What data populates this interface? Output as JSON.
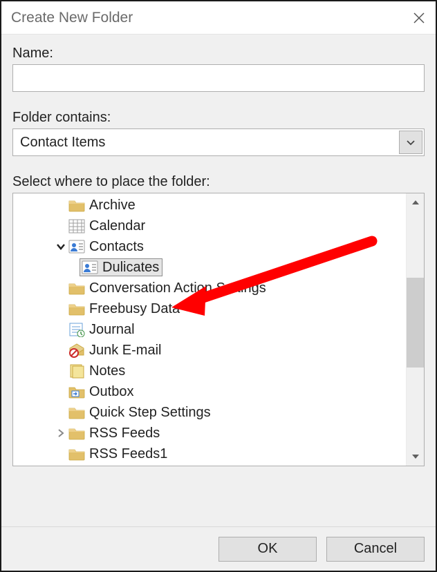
{
  "dialog": {
    "title": "Create New Folder"
  },
  "fields": {
    "name_label": "Name:",
    "name_value": "",
    "contains_label": "Folder contains:",
    "contains_value": "Contact Items",
    "place_label": "Select where to place the folder:"
  },
  "tree": {
    "items": [
      {
        "label": "Archive",
        "icon": "folder",
        "level": 1,
        "expander": "none",
        "selected": false
      },
      {
        "label": "Calendar",
        "icon": "calendar",
        "level": 1,
        "expander": "none",
        "selected": false
      },
      {
        "label": "Contacts",
        "icon": "contacts",
        "level": 1,
        "expander": "open",
        "selected": false
      },
      {
        "label": "Dulicates",
        "icon": "contacts",
        "level": 2,
        "expander": "none",
        "selected": true
      },
      {
        "label": "Conversation Action Settings",
        "icon": "folder",
        "level": 1,
        "expander": "none",
        "selected": false
      },
      {
        "label": "Freebusy Data",
        "icon": "folder",
        "level": 1,
        "expander": "none",
        "selected": false
      },
      {
        "label": "Journal",
        "icon": "journal",
        "level": 1,
        "expander": "none",
        "selected": false
      },
      {
        "label": "Junk E-mail",
        "icon": "junk",
        "level": 1,
        "expander": "none",
        "selected": false
      },
      {
        "label": "Notes",
        "icon": "notes",
        "level": 1,
        "expander": "none",
        "selected": false
      },
      {
        "label": "Outbox",
        "icon": "outbox",
        "level": 1,
        "expander": "none",
        "selected": false
      },
      {
        "label": "Quick Step Settings",
        "icon": "folder",
        "level": 1,
        "expander": "none",
        "selected": false
      },
      {
        "label": "RSS Feeds",
        "icon": "folder",
        "level": 1,
        "expander": "closed",
        "selected": false
      },
      {
        "label": "RSS Feeds1",
        "icon": "folder",
        "level": 1,
        "expander": "none",
        "selected": false
      }
    ]
  },
  "buttons": {
    "ok": "OK",
    "cancel": "Cancel"
  }
}
